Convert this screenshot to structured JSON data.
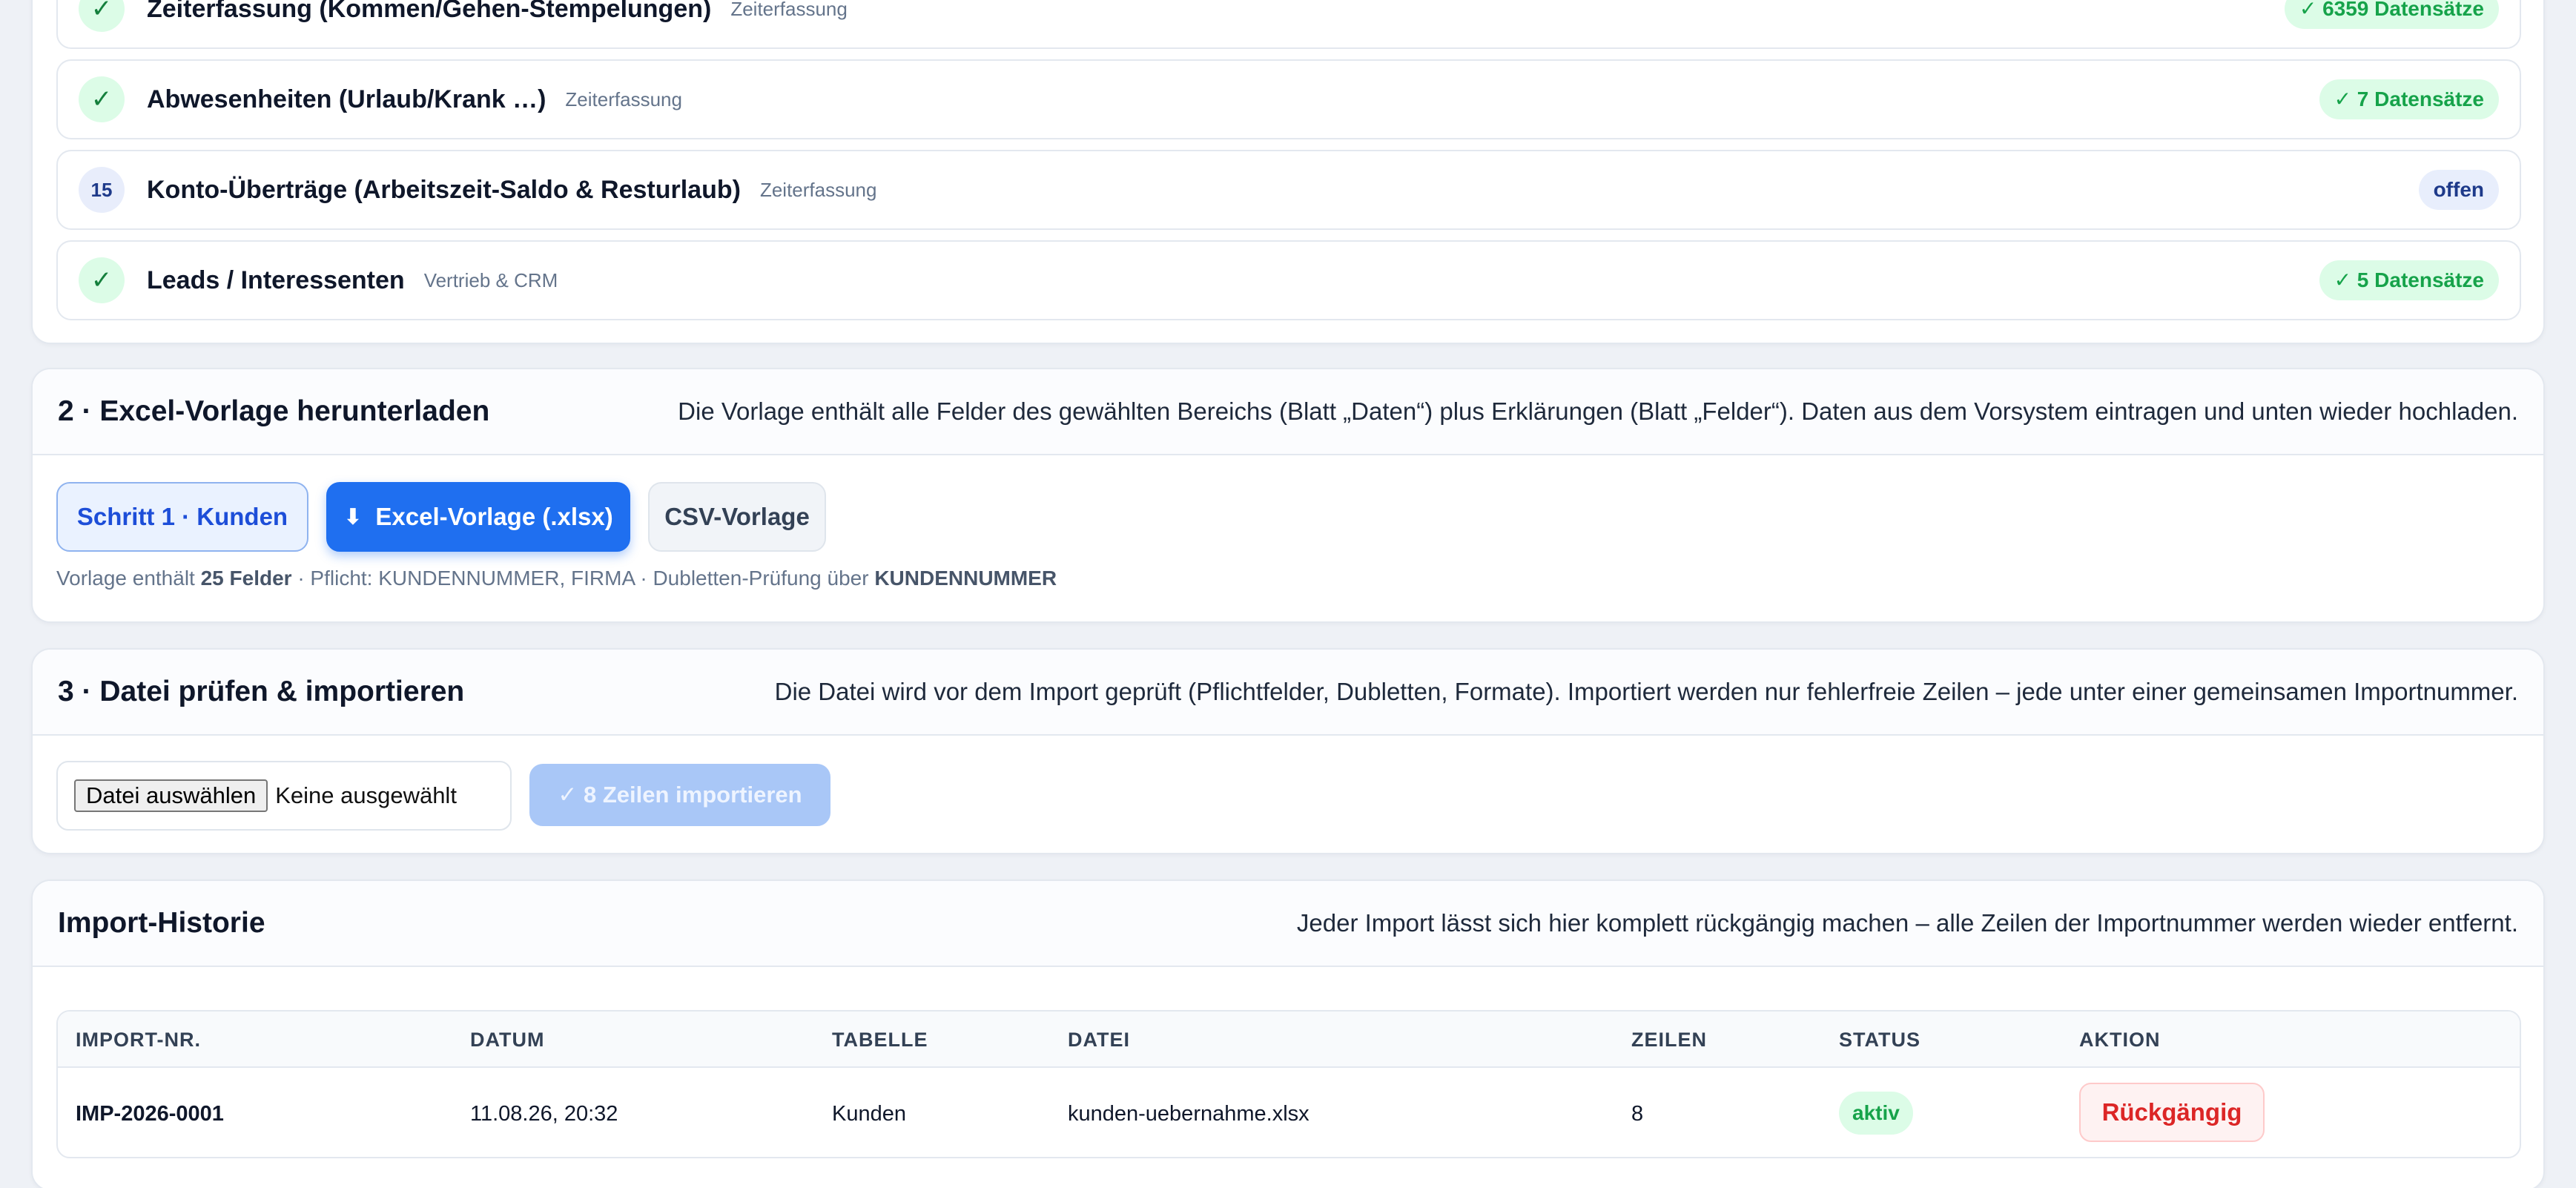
{
  "tables": {
    "items": [
      {
        "marker": "✓",
        "state": "done",
        "title": "Zeiterfassung (Kommen/Gehen-Stempelungen)",
        "category": "Zeiterfassung",
        "badge": "✓ 6359 Datensätze"
      },
      {
        "marker": "✓",
        "state": "done",
        "title": "Abwesenheiten (Urlaub/Krank …)",
        "category": "Zeiterfassung",
        "badge": "✓ 7 Datensätze"
      },
      {
        "marker": "15",
        "state": "open",
        "title": "Konto-Überträge (Arbeitszeit-Saldo & Resturlaub)",
        "category": "Zeiterfassung",
        "badge": "offen"
      },
      {
        "marker": "✓",
        "state": "done",
        "title": "Leads / Interessenten",
        "category": "Vertrieb & CRM",
        "badge": "✓ 5 Datensätze"
      }
    ]
  },
  "download": {
    "title": "2 · Excel-Vorlage herunterladen",
    "description": "Die Vorlage enthält alle Felder des gewählten Bereichs (Blatt „Daten“) plus Erklärungen (Blatt „Felder“). Daten aus dem Vorsystem eintragen und unten wieder hochladen.",
    "step_label": "Schritt 1 · Kunden",
    "xlsx_icon": "⬇",
    "xlsx_label": "Excel-Vorlage (.xlsx)",
    "csv_label": "CSV-Vorlage",
    "hint_prefix": "Vorlage enthält ",
    "hint_fields": "25 Felder",
    "hint_middle": " · Pflicht: KUNDENNUMMER, FIRMA · Dubletten-Prüfung über ",
    "hint_key": "KUNDENNUMMER"
  },
  "import": {
    "title": "3 · Datei prüfen & importieren",
    "description": "Die Datei wird vor dem Import geprüft (Pflichtfelder, Dubletten, Formate). Importiert werden nur fehlerfreie Zeilen – jede unter einer gemeinsamen Importnummer.",
    "file_button": "Datei auswählen",
    "file_status": "Keine ausgewählt",
    "import_button": "✓ 8 Zeilen importieren"
  },
  "history": {
    "title": "Import-Historie",
    "description": "Jeder Import lässt sich hier komplett rückgängig machen – alle Zeilen der Importnummer werden wieder entfernt.",
    "columns": [
      "IMPORT-NR.",
      "DATUM",
      "TABELLE",
      "DATEI",
      "ZEILEN",
      "STATUS",
      "AKTION"
    ],
    "rows": [
      {
        "import_nr": "IMP-2026-0001",
        "datum": "11.08.26, 20:32",
        "tabelle": "Kunden",
        "datei": "kunden-uebernahme.xlsx",
        "zeilen": "8",
        "status": "aktiv",
        "aktion": "Rückgängig"
      }
    ]
  },
  "colors": {
    "accent": "#1f6ff0",
    "success": "#16a34a",
    "danger": "#dc2626",
    "background": "#eef1f6"
  }
}
